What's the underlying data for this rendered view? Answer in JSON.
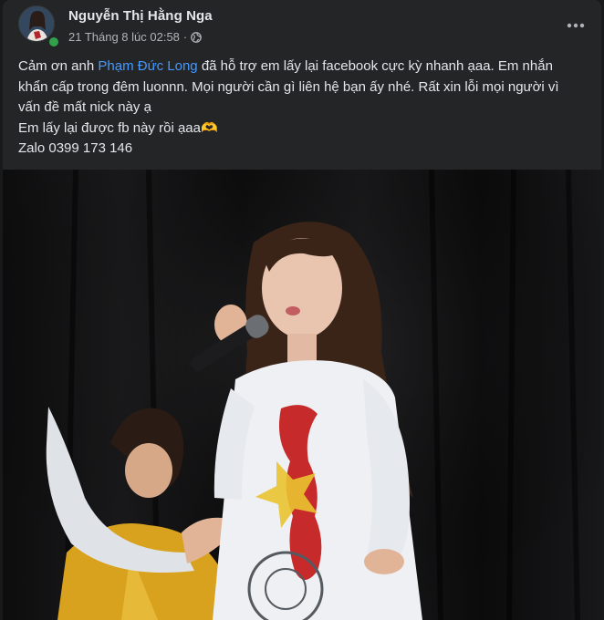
{
  "post": {
    "author": "Nguyễn Thị Hằng Nga",
    "date": "21 Tháng 8 lúc 02:58",
    "separator": "·",
    "privacy_icon": "globe-icon",
    "more_icon": "more-options-icon",
    "text": {
      "intro": "Cảm ơn anh ",
      "mention": "Phạm Đức Long",
      "line1_rest": " đã hỗ trợ em lấy lại facebook cực kỳ nhanh ạaa. Em nhắn khẩn cấp trong đêm luonnn. Mọi người cần gì liên hệ bạn ấy nhé. Rất xin lỗi mọi người vì vấn đề mất nick này ạ",
      "line2": "Em lấy lại được fb này rồi ạaa🫶",
      "line3": "Zalo 0399 173 146"
    },
    "online": true
  },
  "colors": {
    "background": "#18191a",
    "card": "#242526",
    "text_primary": "#e4e6eb",
    "text_secondary": "#b0b3b8",
    "mention": "#4599ff",
    "online": "#31a24c"
  }
}
